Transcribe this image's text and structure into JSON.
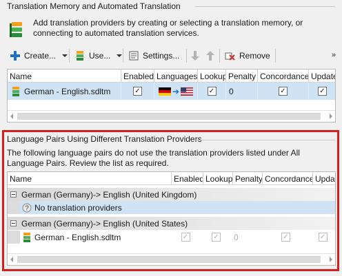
{
  "tm_section": {
    "title": "Translation Memory and Automated Translation",
    "intro": "Add translation providers by creating or selecting a translation memory, or connecting to automated translation services."
  },
  "toolbar": {
    "create_label": "Create...",
    "use_label": "Use...",
    "settings_label": "Settings...",
    "remove_label": "Remove",
    "more_label": "»"
  },
  "tm_grid": {
    "columns": [
      "Name",
      "Enabled",
      "Languages",
      "Lookup",
      "Penalty",
      "Concordance",
      "Update"
    ],
    "row": {
      "name": "German - English.sdltm",
      "enabled": true,
      "source_flag": "de",
      "target_flag": "us",
      "lookup": true,
      "penalty": "0",
      "concordance": true,
      "update": true
    }
  },
  "lp_section": {
    "title": "Language Pairs Using Different Translation Providers",
    "description": "The following language pairs do not use the translation providers listed under All Language Pairs. Review the list as required."
  },
  "lp_grid": {
    "columns": [
      "Name",
      "Enabled",
      "Lookup",
      "Penalty",
      "Concordance",
      "Update"
    ],
    "group1": "German (Germany)-> English (United Kingdom)",
    "no_providers": "No translation providers",
    "group2": "German (Germany)-> English (United States)",
    "provider_row": {
      "name": "German - English.sdltm",
      "penalty": "0"
    }
  },
  "colors": {
    "highlight": "#d41f1f",
    "selection": "#cfe3f5"
  }
}
